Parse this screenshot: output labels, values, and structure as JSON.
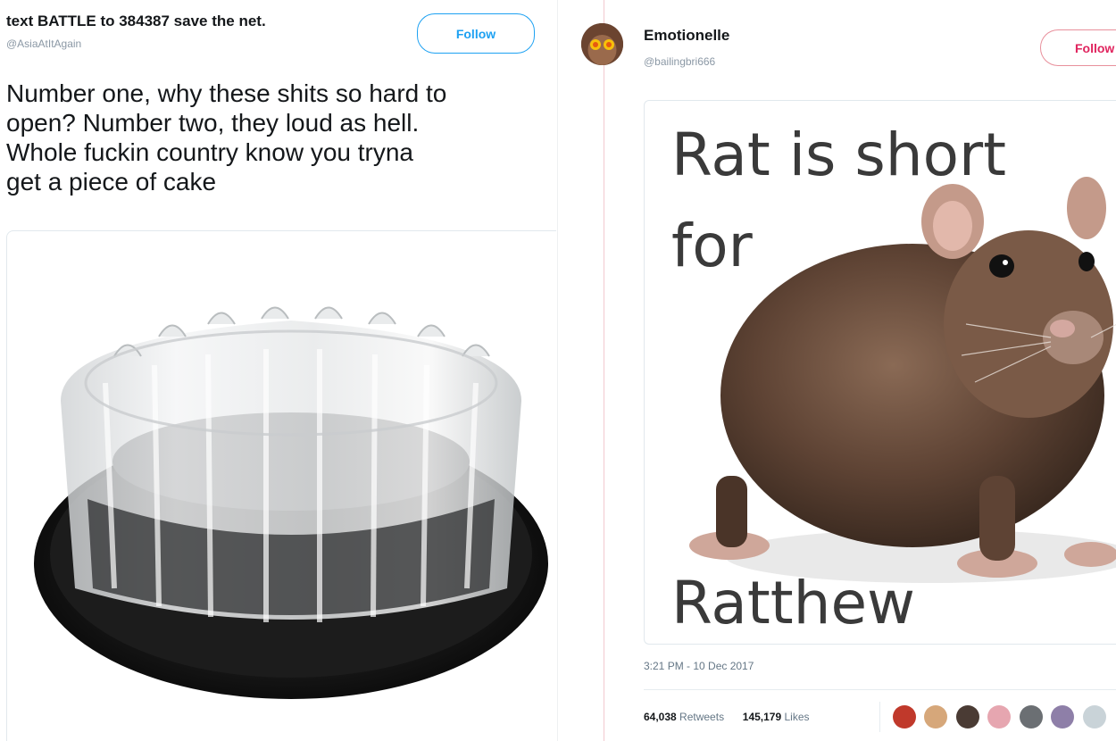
{
  "left_tweet": {
    "display_name": "text BATTLE to 384387 save the net.",
    "handle": "@AsiaAtItAgain",
    "follow_label": "Follow",
    "text_lines": [
      "Number one, why these shits so hard to",
      "open? Number two, they loud as hell.",
      "Whole fuckin country know you tryna",
      "get a piece of cake"
    ],
    "media_icon": "cake-container-image"
  },
  "right_tweet": {
    "display_name": "Emotionelle",
    "handle": "@bailingbri666",
    "follow_label": "Follow",
    "meme": {
      "line1": "Rat is short",
      "line2": "for",
      "line3": "Ratthew"
    },
    "timestamp": "3:21 PM - 10 Dec 2017",
    "retweets_count": "64,038",
    "retweets_label": "Retweets",
    "likes_count": "145,179",
    "likes_label": "Likes",
    "media_icon": "rat-image",
    "avatar_icon": "avatar-icon"
  },
  "colors": {
    "accent": "#1da1f2",
    "text": "#14171a",
    "muted": "#8b98a5"
  }
}
